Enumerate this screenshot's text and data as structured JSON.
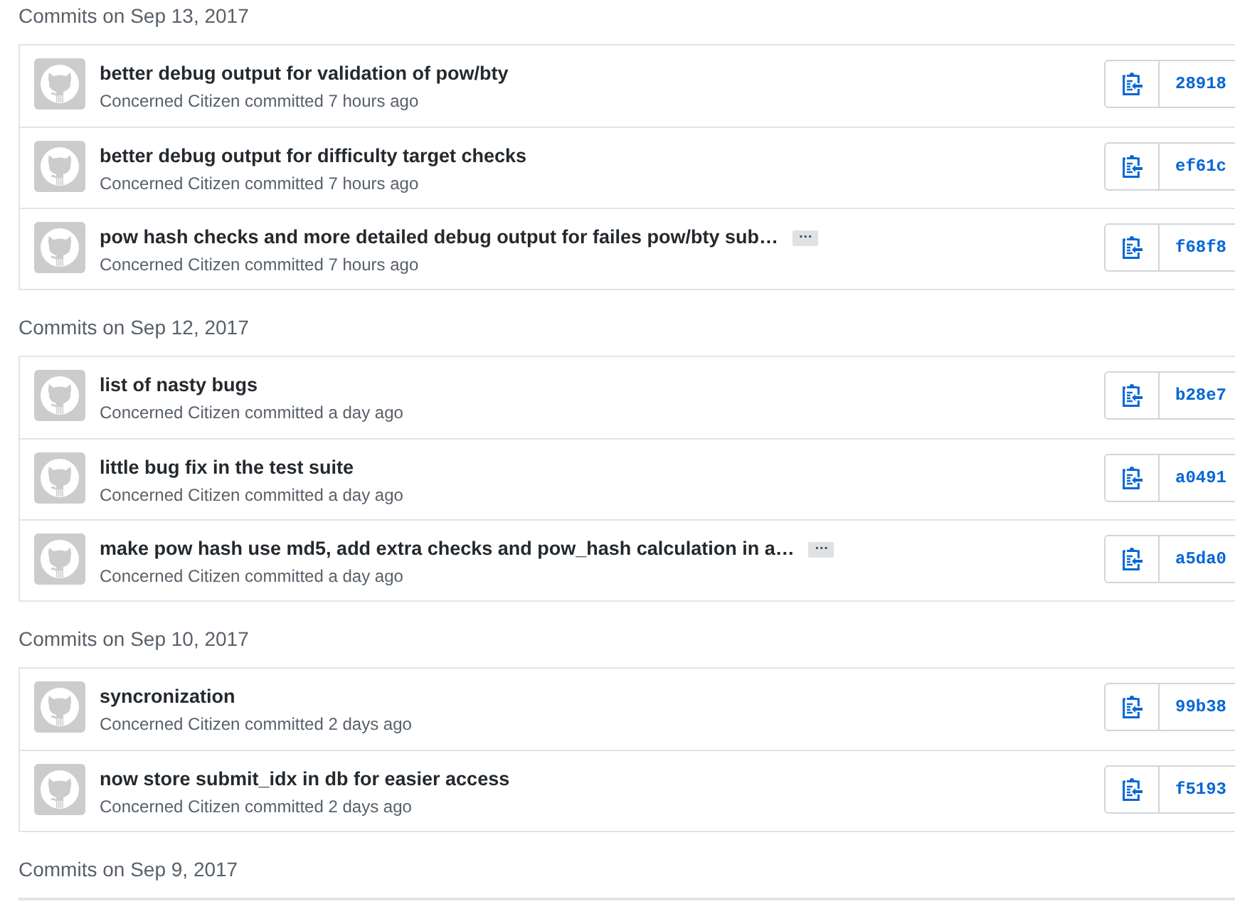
{
  "groups": [
    {
      "heading": "Commits on Sep 13, 2017",
      "commits": [
        {
          "title": "better debug output for validation of pow/bty",
          "byline": "Concerned Citizen committed 7 hours ago",
          "sha": "28918"
        },
        {
          "title": "better debug output for difficulty target checks",
          "byline": "Concerned Citizen committed 7 hours ago",
          "sha": "ef61c"
        },
        {
          "title": "pow hash checks and more detailed debug output for failes pow/bty sub…",
          "expander": "…",
          "byline": "Concerned Citizen committed 7 hours ago",
          "sha": "f68f8"
        }
      ]
    },
    {
      "heading": "Commits on Sep 12, 2017",
      "commits": [
        {
          "title": "list of nasty bugs",
          "byline": "Concerned Citizen committed a day ago",
          "sha": "b28e7"
        },
        {
          "title": "little bug fix in the test suite",
          "byline": "Concerned Citizen committed a day ago",
          "sha": "a0491"
        },
        {
          "title": "make pow hash use md5, add extra checks and pow_hash calculation in a…",
          "expander": "…",
          "byline": "Concerned Citizen committed a day ago",
          "sha": "a5da0"
        }
      ]
    },
    {
      "heading": "Commits on Sep 10, 2017",
      "commits": [
        {
          "title": "syncronization",
          "byline": "Concerned Citizen committed 2 days ago",
          "sha": "99b38"
        },
        {
          "title": "now store submit_idx in db for easier access",
          "byline": "Concerned Citizen committed 2 days ago",
          "sha": "f5193"
        }
      ]
    },
    {
      "heading": "Commits on Sep 9, 2017"
    }
  ]
}
